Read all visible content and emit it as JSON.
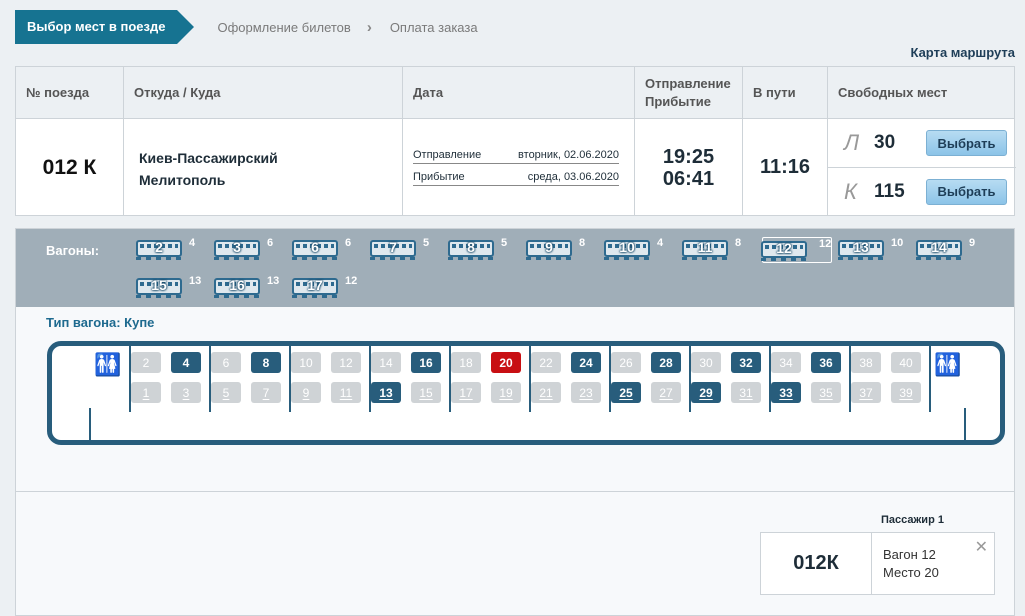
{
  "steps": {
    "active": "Выбор мест в поезде",
    "step2": "Оформление билетов",
    "step3": "Оплата заказа"
  },
  "route_link": "Карта маршрута",
  "table": {
    "headers": {
      "num": "№ поезда",
      "from_to": "Откуда / Куда",
      "date": "Дата",
      "dep1": "Отправление",
      "dep2": "Прибытие",
      "duration": "В пути",
      "free": "Свободных мест"
    },
    "train_num": "012 К",
    "from": "Киев-Пассажирский",
    "to": "Мелитополь",
    "dep_label": "Отправление",
    "dep_date": "вторник, 02.06.2020",
    "arr_label": "Прибытие",
    "arr_date": "среда, 03.06.2020",
    "dep_time": "19:25",
    "arr_time": "06:41",
    "duration": "11:16",
    "types": [
      {
        "letter": "Л",
        "count": "30",
        "btn": "Выбрать"
      },
      {
        "letter": "К",
        "count": "115",
        "btn": "Выбрать"
      }
    ]
  },
  "wagons_label": "Вагоны:",
  "wagons": [
    {
      "num": "2",
      "free": "4"
    },
    {
      "num": "3",
      "free": "6"
    },
    {
      "num": "6",
      "free": "6"
    },
    {
      "num": "7",
      "free": "5"
    },
    {
      "num": "8",
      "free": "5"
    },
    {
      "num": "9",
      "free": "8"
    },
    {
      "num": "10",
      "free": "4"
    },
    {
      "num": "11",
      "free": "8"
    },
    {
      "num": "12",
      "free": "12"
    },
    {
      "num": "13",
      "free": "10"
    },
    {
      "num": "14",
      "free": "9"
    },
    {
      "num": "15",
      "free": "13"
    },
    {
      "num": "16",
      "free": "13"
    },
    {
      "num": "17",
      "free": "12"
    }
  ],
  "selected_wagon": "12",
  "wagon_type": "Тип вагона: Купе",
  "seats_top": [
    "2",
    "4",
    "6",
    "8",
    "10",
    "12",
    "14",
    "16",
    "18",
    "20",
    "22",
    "24",
    "26",
    "28",
    "30",
    "32",
    "34",
    "36",
    "38",
    "40"
  ],
  "seats_bottom": [
    "1",
    "3",
    "5",
    "7",
    "9",
    "11",
    "13",
    "15",
    "17",
    "19",
    "21",
    "23",
    "25",
    "27",
    "29",
    "31",
    "33",
    "35",
    "37",
    "39"
  ],
  "available": [
    "4",
    "8",
    "13",
    "16",
    "24",
    "25",
    "28",
    "29",
    "32",
    "33",
    "36"
  ],
  "selected_seat": "20",
  "passenger": {
    "label": "Пассажир 1",
    "train": "012К",
    "wagon": "Вагон 12",
    "seat": "Место 20"
  }
}
